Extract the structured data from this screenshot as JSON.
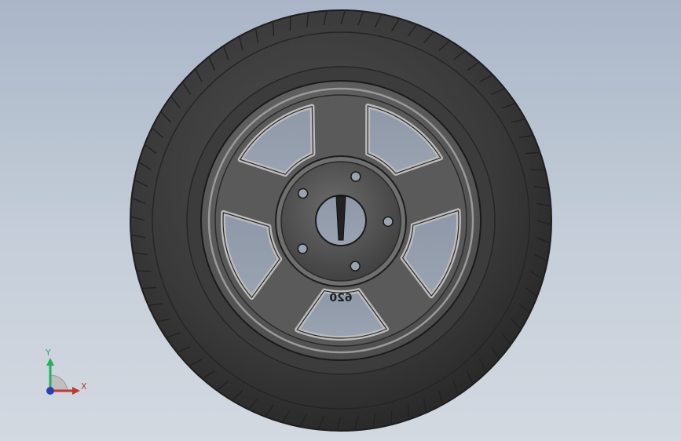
{
  "viewport": {
    "background_top": "#aab6c8",
    "background_bottom": "#d3d9e1"
  },
  "model": {
    "description_icon": "wheel-assembly",
    "sidewall_text": "620"
  },
  "triad": {
    "x_label": "X",
    "y_label": "Y",
    "x_color": "#c0392b",
    "y_color": "#27ae60",
    "z_color": "#2b3fb0"
  }
}
